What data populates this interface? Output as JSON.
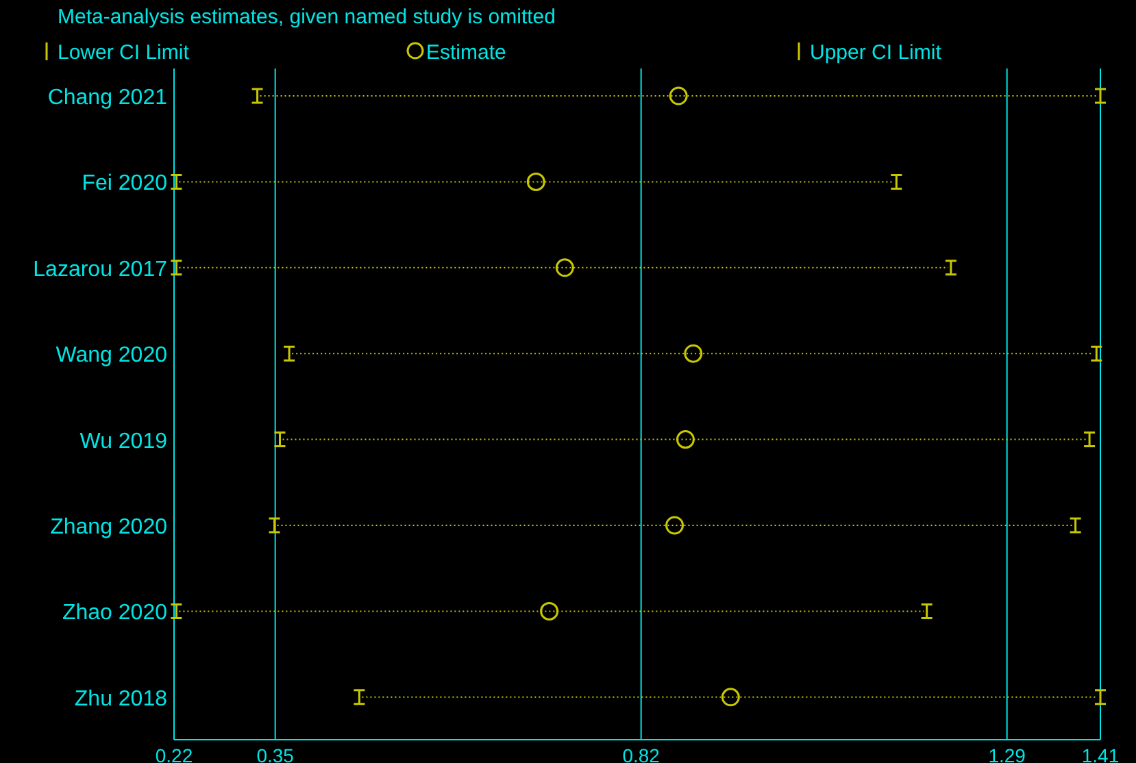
{
  "chart": {
    "chart_data": {
      "type": "scatter",
      "orientation": "horizontal",
      "title": "Meta-analysis estimates, given named study is omitted",
      "categories": [
        "Chang 2021",
        "Fei 2020",
        "Lazarou 2017",
        "Wang 2020",
        "Wu 2019",
        "Zhang 2020",
        "Zhao 2020",
        "Zhu 2018"
      ],
      "series": [
        {
          "name": "Lower CI Limit",
          "color": "#c8c800",
          "values": [
            0.327,
            0.223,
            0.223,
            0.368,
            0.356,
            0.349,
            0.223,
            0.458
          ]
        },
        {
          "name": "Estimate",
          "color": "#c8c800",
          "values": [
            0.868,
            0.685,
            0.722,
            0.887,
            0.877,
            0.863,
            0.702,
            0.935
          ]
        },
        {
          "name": "Upper CI Limit",
          "color": "#c8c800",
          "values": [
            1.41,
            1.148,
            1.218,
            1.405,
            1.396,
            1.378,
            1.187,
            1.41
          ]
        }
      ],
      "xlim": [
        0.22,
        1.41
      ],
      "grid": true,
      "legend": "top",
      "xticks": [
        {
          "value": 0.22,
          "label": "0.22"
        },
        {
          "value": 0.35,
          "label": "0.35"
        },
        {
          "value": 0.82,
          "label": "0.82"
        },
        {
          "value": 1.29,
          "label": "1.29"
        },
        {
          "value": 1.41,
          "label": "1.41"
        }
      ]
    }
  }
}
